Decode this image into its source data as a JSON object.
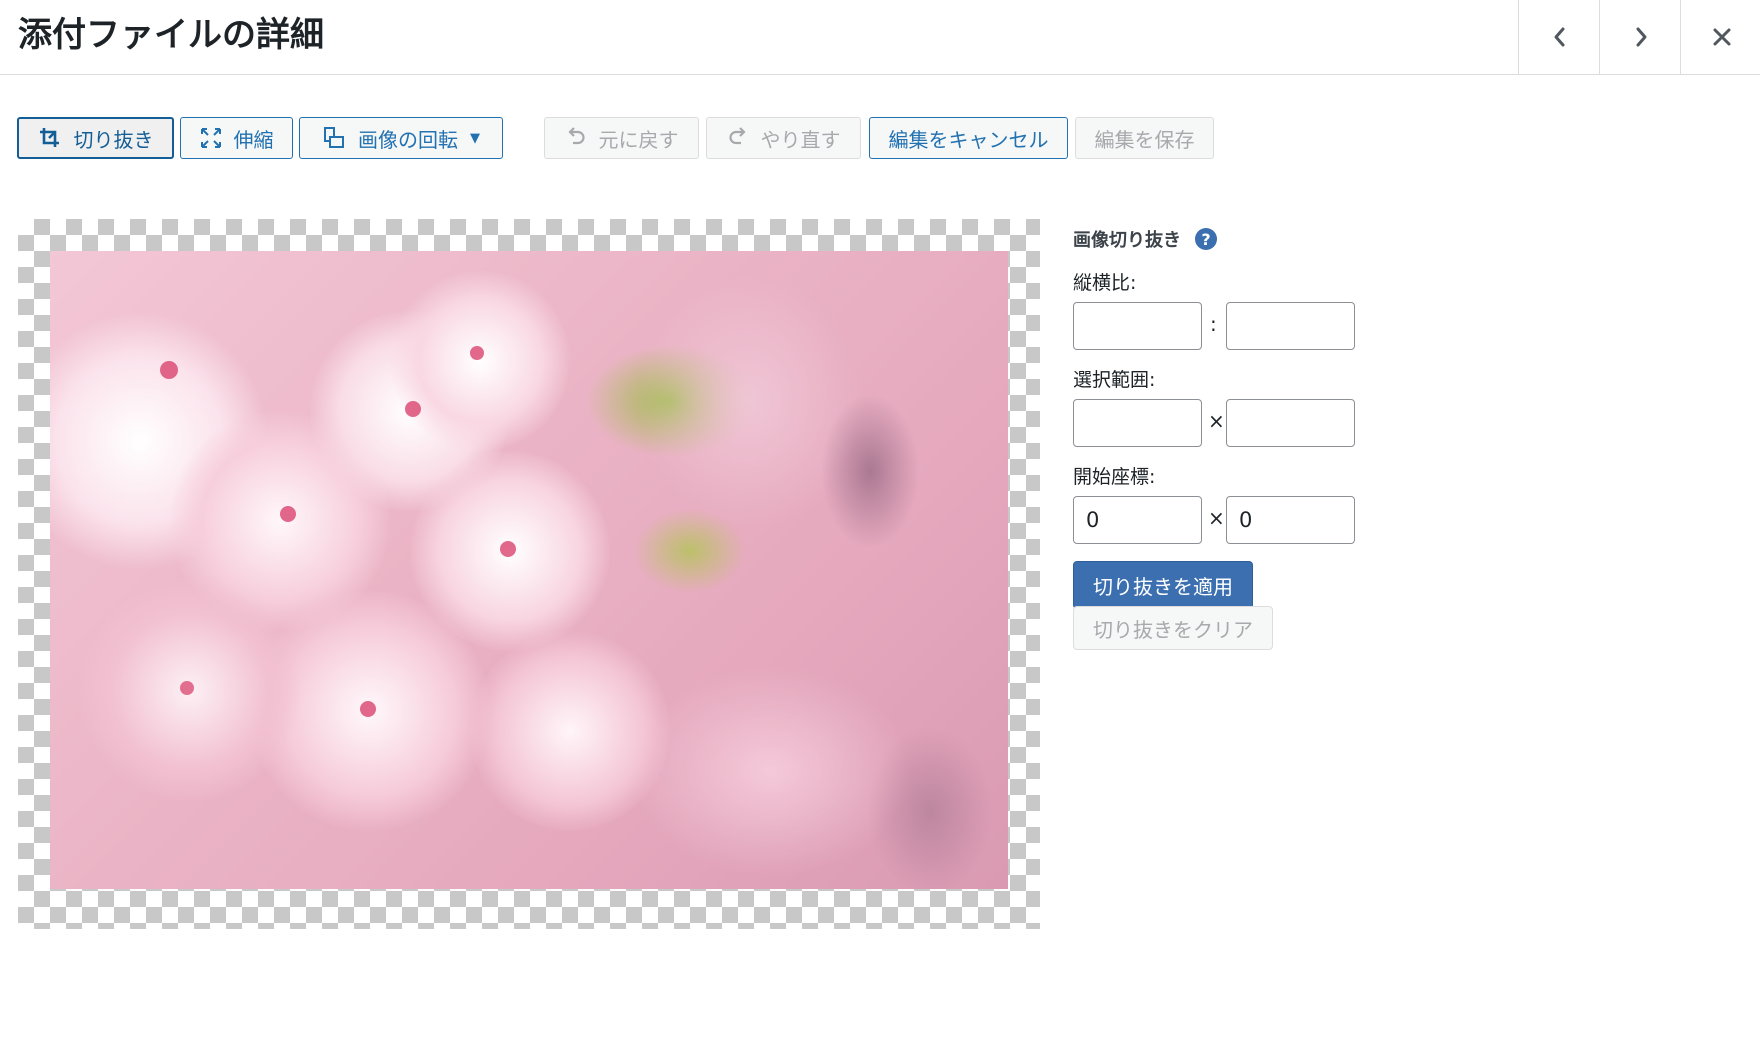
{
  "header": {
    "title": "添付ファイルの詳細",
    "prev_icon": "chevron-left-icon",
    "next_icon": "chevron-right-icon",
    "close_icon": "close-icon"
  },
  "toolbar": {
    "crop": "切り抜き",
    "scale": "伸縮",
    "rotate": "画像の回転",
    "undo": "元に戻す",
    "redo": "やり直す",
    "cancel": "編集をキャンセル",
    "save": "編集を保存"
  },
  "crop_panel": {
    "title": "画像切り抜き",
    "help": "?",
    "aspect_label": "縦横比:",
    "aspect_sep": ":",
    "aspect_w": "",
    "aspect_h": "",
    "selection_label": "選択範囲:",
    "selection_sep": "×",
    "selection_w": "",
    "selection_h": "",
    "start_label": "開始座標:",
    "start_sep": "×",
    "start_x": "0",
    "start_y": "0",
    "apply": "切り抜きを適用",
    "clear": "切り抜きをクリア"
  },
  "colors": {
    "accent": "#2271b1",
    "primary_button": "#3b6fb0",
    "disabled_text": "#a7aaad",
    "border": "#dcdcde"
  }
}
